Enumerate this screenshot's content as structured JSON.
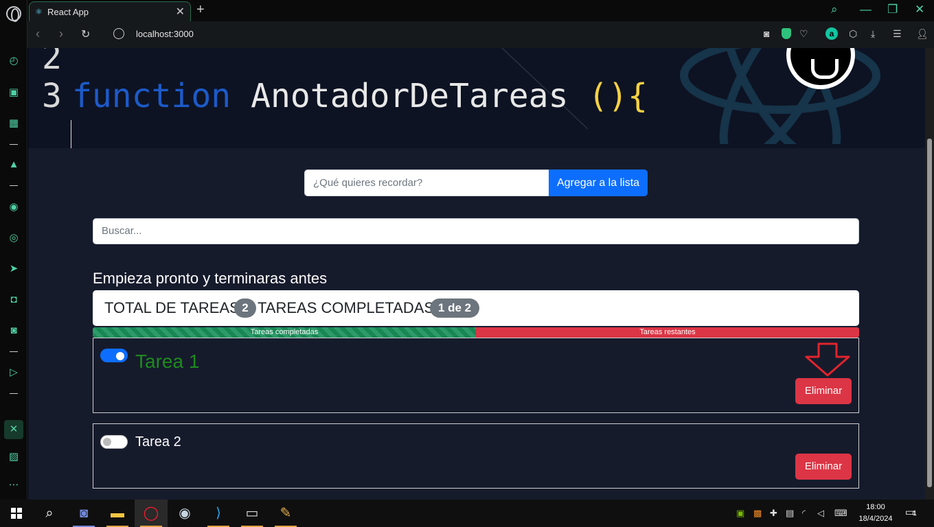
{
  "browser": {
    "tab_title": "React App",
    "url": "localhost:3000"
  },
  "hero": {
    "line_2": "2",
    "line_3": "3",
    "keyword": "function",
    "function_name": "AnotadorDeTareas",
    "parens": "()",
    "brace": "{"
  },
  "add_task": {
    "placeholder": "¿Qué quieres recordar?",
    "button_label": "Agregar a la lista"
  },
  "search": {
    "placeholder": "Buscar..."
  },
  "motto": "Empieza pronto y terminaras antes",
  "stats": {
    "total_label": "TOTAL DE TAREAS",
    "total_count": "2",
    "completed_label": "TAREAS COMPLETADAS:",
    "completed_badge": "1 de 2"
  },
  "progress": {
    "completed_label": "Tareas completadas",
    "remaining_label": "Tareas restantes",
    "completed_fraction": 0.5
  },
  "tasks": [
    {
      "name": "Tarea 1",
      "done": true,
      "delete_label": "Eliminar"
    },
    {
      "name": "Tarea 2",
      "done": false,
      "delete_label": "Eliminar"
    }
  ],
  "taskbar": {
    "time": "18:00",
    "date": "18/4/2024",
    "notifications": "1"
  },
  "colors": {
    "accent": "#0d6efd",
    "danger": "#dc3545",
    "success": "#198754",
    "done_text": "#1e8a1e",
    "page_bg": "#161b2c"
  }
}
